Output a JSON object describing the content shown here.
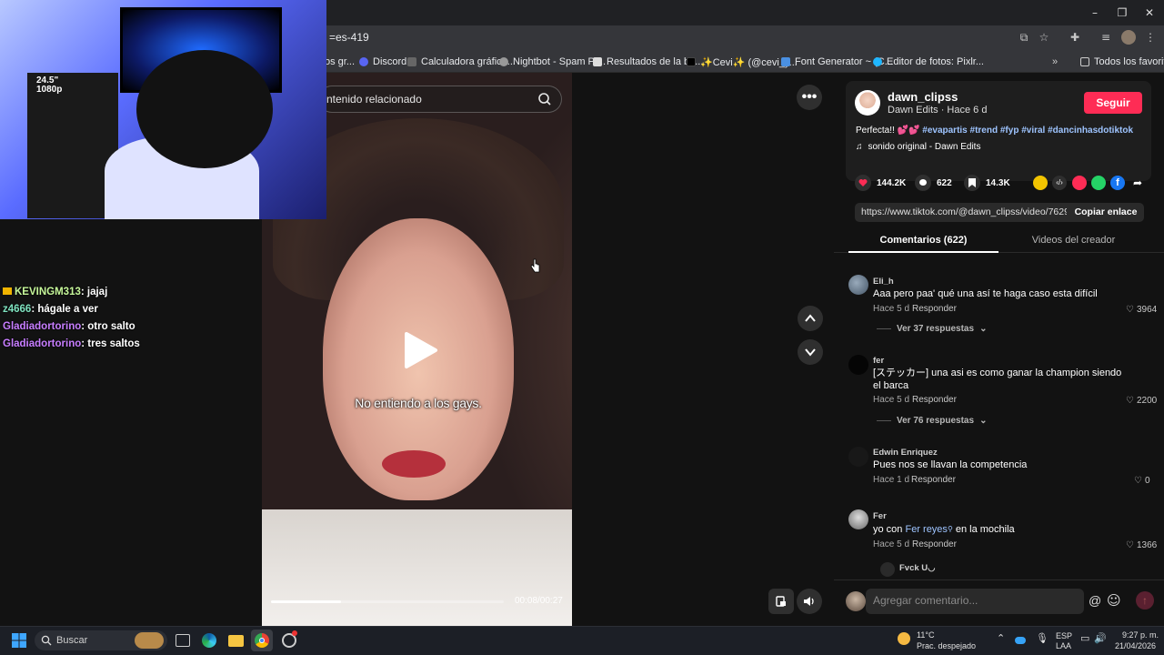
{
  "browser": {
    "url_fragment": "=es-419",
    "bookmarks": [
      {
        "label": "os gr...",
        "color": "#8ab4f8"
      },
      {
        "label": "Discord",
        "color": "#5865f2"
      },
      {
        "label": "Calculadora gráfica...",
        "color": "#888888"
      },
      {
        "label": "Nightbot - Spam Pr...",
        "color": "#aaaaaa"
      },
      {
        "label": "Resultados de la bú...",
        "color": "#dddddd"
      },
      {
        "label": "✨Cevi✨ (@cevi_y...",
        "color": "#000000"
      },
      {
        "label": "Font Generator ~ (C...",
        "color": "#4a90e2"
      },
      {
        "label": "Editor de fotos: Pixlr...",
        "color": "#1fb6ff"
      }
    ],
    "all_bookmarks": "Todos los favoritos",
    "window_controls": {
      "minimize": "–",
      "maximize": "❐",
      "close": "✕"
    }
  },
  "video": {
    "search_placeholder": "ntenido relacionado",
    "caption": "No entiendo a los gays.",
    "progress_fraction": 0.3,
    "time": "00:08/00:27"
  },
  "webcam": {
    "monitor_label_1": "24.5\"",
    "monitor_label_2": "1080p"
  },
  "chat": [
    {
      "user": "KEVINGM313",
      "text": ": jajaj",
      "color": "#c6f79a",
      "badge": true
    },
    {
      "user": "z4666",
      "text": ": hágale a ver",
      "color": "#7fe3c0",
      "badge": false
    },
    {
      "user": "Gladiadortorino",
      "text": ": otro salto",
      "color": "#c77dff",
      "badge": false
    },
    {
      "user": "Gladiadortorino",
      "text": ": tres saltos",
      "color": "#c77dff",
      "badge": false
    }
  ],
  "author": {
    "username": "dawn_clipss",
    "subtitle": "Dawn Edits · Hace 6 d",
    "follow_label": "Seguir",
    "description_text": "Perfecta!! 💕💕 ",
    "hashtags": "#evapartis #trend #fyp #viral #dancinhasdotiktok",
    "sound": "sonido original - Dawn Edits"
  },
  "stats": {
    "likes": "144.2K",
    "comments": "622",
    "saves": "14.3K"
  },
  "link": {
    "url": "https://www.tiktok.com/@dawn_clipss/video/7629...",
    "copy_label": "Copiar enlace"
  },
  "tabs": {
    "comments": "Comentarios (622)",
    "creator_videos": "Videos del creador"
  },
  "comments": [
    {
      "user": "Eli_h",
      "text": "Aaa pero paa' qué una así te haga caso esta difícil",
      "time": "Hace 5 d",
      "reply": "Responder",
      "likes": "3964",
      "replies": "Ver 37 respuestas"
    },
    {
      "user": "fer",
      "text": "[ステッカー] una asi es como ganar la champion siendo el barca",
      "time": "Hace 5 d",
      "reply": "Responder",
      "likes": "2200",
      "replies": "Ver 76 respuestas"
    },
    {
      "user": "Edwin Enriquez",
      "text": "Pues nos se llavan la competencia",
      "time": "Hace 1 d",
      "reply": "Responder",
      "likes": "0"
    },
    {
      "user": "Fer",
      "text_before": "yo con ",
      "mention": "Fer reyes",
      "text_after": " en la mochila",
      "time": "Hace 5 d",
      "reply": "Responder",
      "likes": "1366"
    },
    {
      "user": "Fvck U◡"
    }
  ],
  "comment_input": {
    "placeholder": "Agregar comentario..."
  },
  "taskbar": {
    "search": "Buscar",
    "weather_temp": "11°C",
    "weather_desc": "Prac. despejado",
    "lang_1": "ESP",
    "lang_2": "LAA",
    "time": "9:27 p. m.",
    "date": "21/04/2026"
  }
}
